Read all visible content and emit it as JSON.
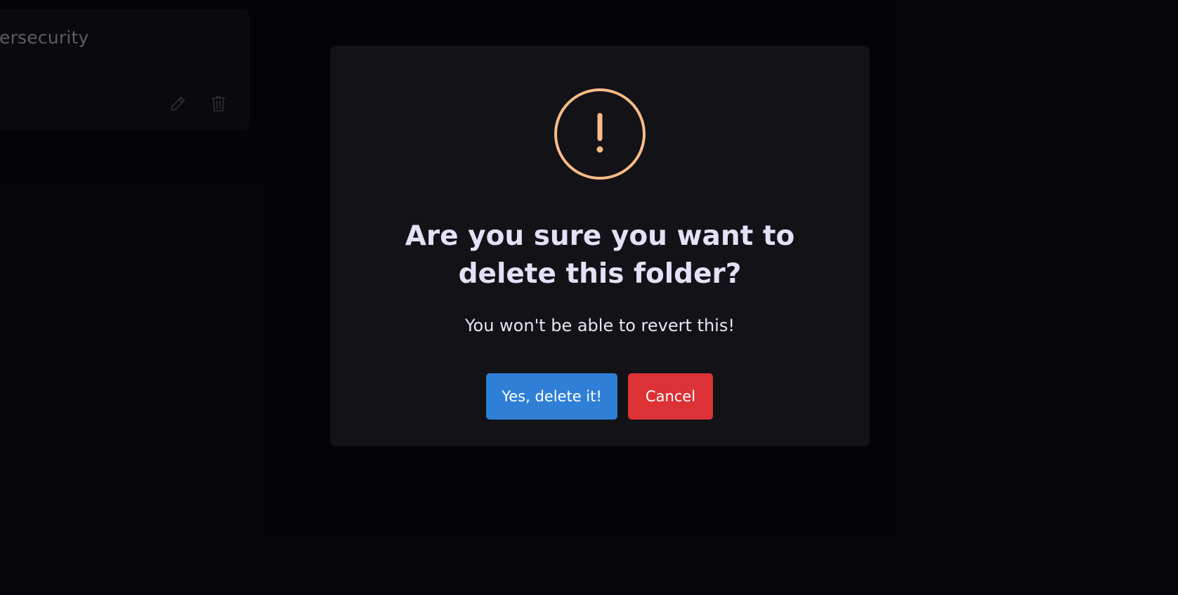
{
  "background": {
    "folder_card": {
      "title": "ersecurity",
      "edit_icon": "pencil-icon",
      "delete_icon": "trash-icon"
    }
  },
  "dialog": {
    "icon": "warning-icon",
    "icon_glyph": "!",
    "title": "Are you sure you want to delete this folder?",
    "text": "You won't be able to revert this!",
    "confirm_label": "Yes, delete it!",
    "cancel_label": "Cancel"
  },
  "colors": {
    "page_bg": "#0b0b0f",
    "modal_bg": "#121217",
    "warning": "#f8bb86",
    "confirm": "#2f7fd6",
    "cancel": "#dc3135",
    "title": "#e4e0f5"
  }
}
